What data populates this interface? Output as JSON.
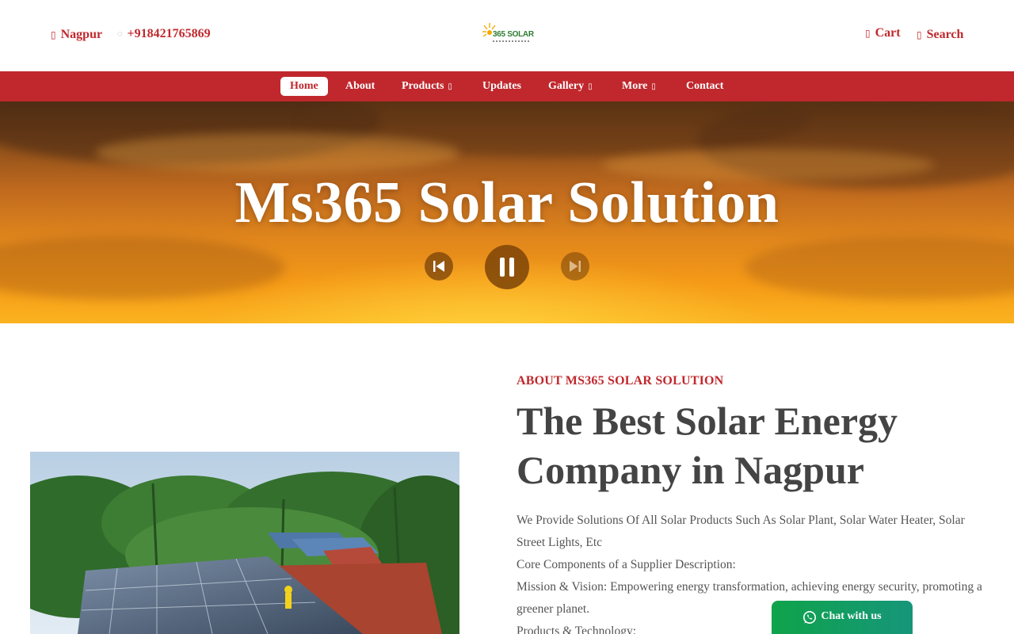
{
  "topbar": {
    "location": "Nagpur",
    "phone": "+918421765869",
    "cart": "Cart",
    "search": "Search",
    "logo_text": "365 SOLAR"
  },
  "nav": {
    "items": [
      {
        "label": "Home"
      },
      {
        "label": "About"
      },
      {
        "label": "Products"
      },
      {
        "label": "Updates"
      },
      {
        "label": "Gallery"
      },
      {
        "label": "More"
      },
      {
        "label": "Contact"
      }
    ]
  },
  "hero": {
    "title": "Ms365 Solar Solution"
  },
  "about": {
    "eyebrow": "ABOUT MS365 SOLAR SOLUTION",
    "heading_line1": "The Best Solar Energy",
    "heading_line2": "Company in Nagpur",
    "para1": "We Provide Solutions Of All Solar Products Such As Solar Plant, Solar Water Heater, Solar Street Lights, Etc",
    "para2": "Core Components of a Supplier Description:",
    "para3": "Mission & Vision: Empowering energy transformation, achieving energy security, promoting a greener planet.",
    "para4": "Products & Technology:"
  },
  "chat": {
    "label": "Chat with us"
  },
  "colors": {
    "brand_red": "#c0282d",
    "whatsapp_green": "#0fa34a"
  },
  "icons": {
    "location": "map-pin-icon",
    "phone": "phone-icon",
    "cart": "cart-icon",
    "search": "search-icon",
    "dropdown": "chevron-down-icon",
    "prev": "skip-previous-icon",
    "pause": "pause-icon",
    "next": "skip-next-icon",
    "chat": "whatsapp-icon"
  }
}
